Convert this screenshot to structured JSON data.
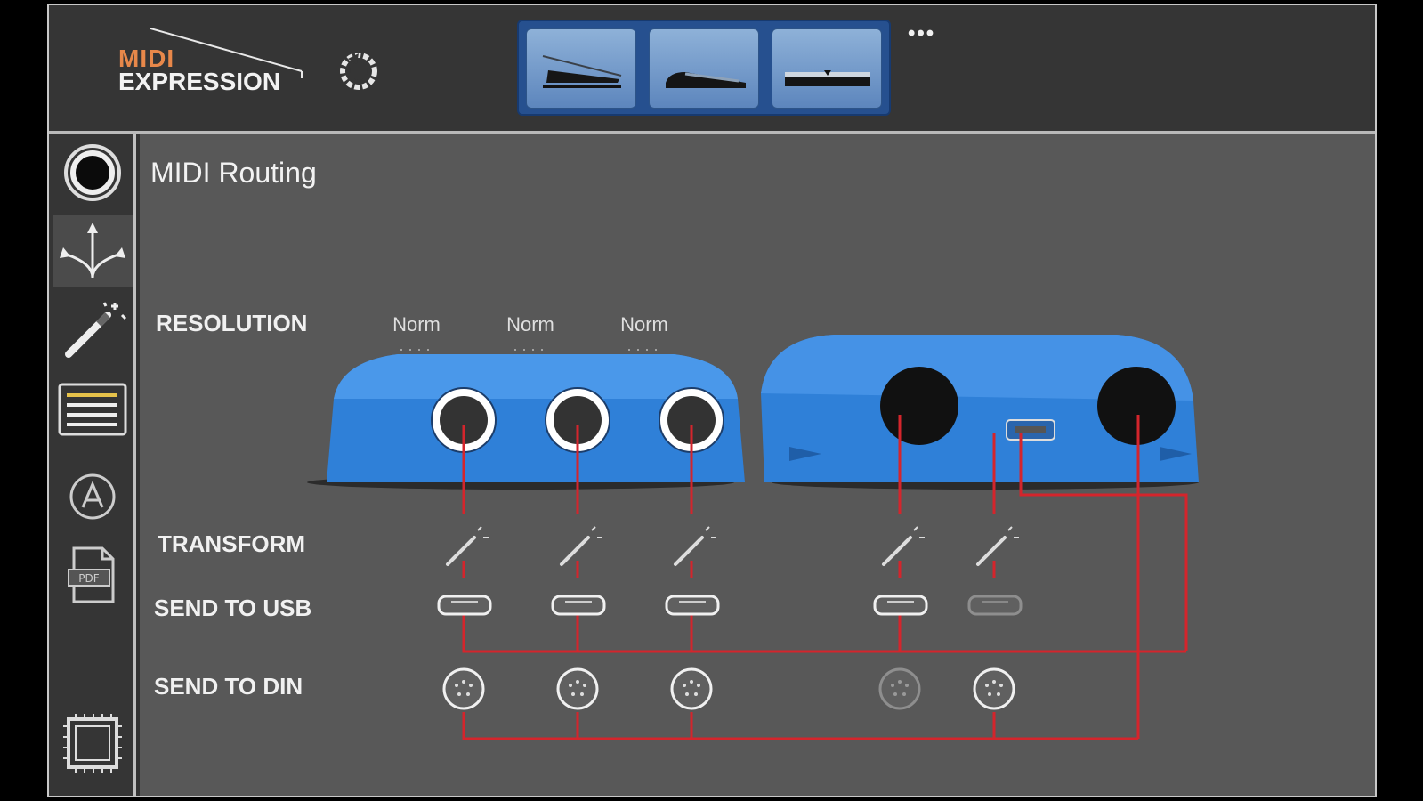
{
  "app": {
    "logo_top": "MIDI",
    "logo_bottom": "EXPRESSION"
  },
  "header": {
    "more_label": "•••",
    "pedal_types": [
      {
        "name": "expression-pedal"
      },
      {
        "name": "sustain-pedal"
      },
      {
        "name": "switch-pedal"
      }
    ]
  },
  "sidebar": {
    "items": [
      {
        "name": "circle-jack-icon",
        "active": false
      },
      {
        "name": "routing-arrows-icon",
        "active": true
      },
      {
        "name": "magic-wand-icon",
        "active": false
      },
      {
        "name": "list-lines-icon",
        "active": false
      },
      {
        "name": "a-circle-icon",
        "active": false
      },
      {
        "name": "pdf-doc-icon",
        "active": false
      },
      {
        "name": "chip-icon",
        "active": false
      }
    ]
  },
  "main": {
    "title": "MIDI Routing",
    "rows": {
      "resolution": "RESOLUTION",
      "transform": "TRANSFORM",
      "send_usb": "SEND TO USB",
      "send_din": "SEND TO DIN"
    },
    "resolution_values": [
      "Norm",
      "Norm",
      "Norm"
    ]
  },
  "colors": {
    "wire": "#d4252c",
    "device_blue": "#2f80d8",
    "accent_orange": "#e8884a"
  }
}
